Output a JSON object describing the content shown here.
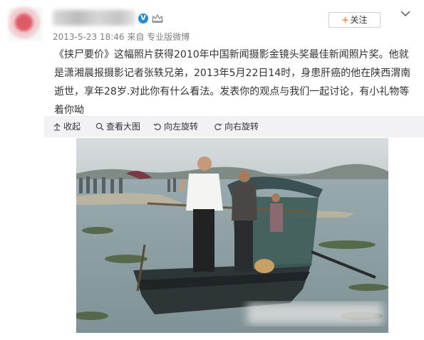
{
  "post": {
    "meta_text": "2013-5-23 18:46 来自 专业版微博",
    "follow_label": "关注",
    "follow_plus": "+",
    "text": "《挟尸要价》这幅照片获得2010年中国新闻摄影金镜头奖最佳新闻照片奖。他就是潇湘晨报摄影记者张轶兄弟，2013年5月22日14时，身患肝癌的他在陕西渭南逝世，享年28岁.对此你有什么看法。发表你的观点与我们一起讨论，有小礼物等着你呦"
  },
  "toolbar": {
    "collapse_label": "收起",
    "view_large_label": "查看大图",
    "rotate_left_label": "向左旋转",
    "rotate_right_label": "向右旋转"
  },
  "icons": {
    "verified": "verified-v-icon",
    "member": "crown-icon",
    "menu": "chevron-down-icon",
    "collapse": "collapse-arrow-icon",
    "view_large": "magnifier-icon",
    "rotate_left": "rotate-left-icon",
    "rotate_right": "rotate-right-icon"
  },
  "colors": {
    "accent": "#ff8140",
    "verified": "#1f8bdb",
    "meta_text": "#808080",
    "toolbar_bg": "#f2f2f5"
  }
}
